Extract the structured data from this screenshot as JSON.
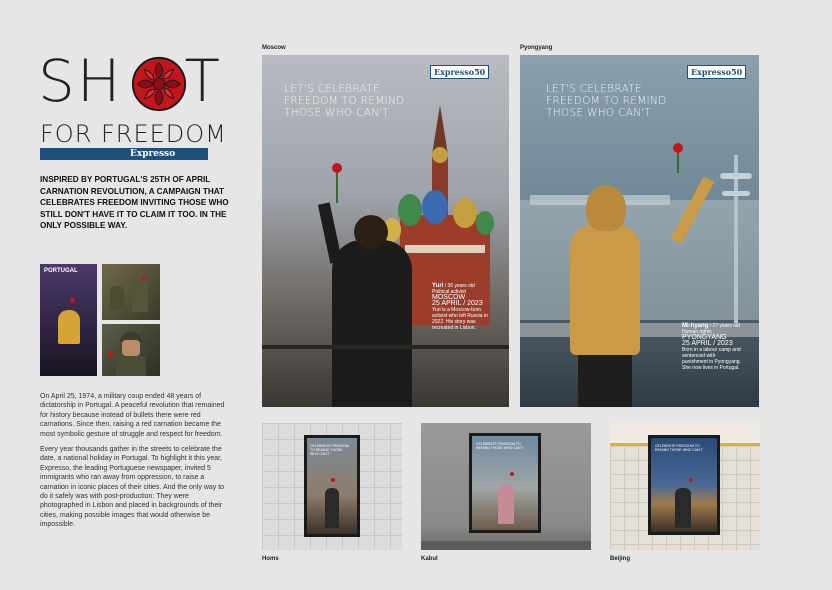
{
  "title": {
    "shot_left": "SH",
    "shot_right": "T",
    "subtitle": "FOR FREEDOM",
    "brand": "Expresso"
  },
  "headline": "INSPIRED BY PORTUGAL'S 25TH OF APRIL CARNATION REVOLUTION, A CAMPAIGN THAT CELEBRATES FREEDOM INVITING THOSE WHO STILL DON'T HAVE IT TO CLAIM IT TOO. IN THE ONLY POSSIBLE WAY.",
  "thumb_poster_text": "PORTUGAL",
  "body": {
    "p1": "On April 25, 1974, a military coup ended 48 years of dictatorship in Portugal. A peaceful revolution that remained for history because instead of bullets there were red carnations. Since then, raising a red carnation became the most symbolic gesture of struggle and respect for freedom.",
    "p2": "Every year thousands gather in the streets to celebrate the date, a national holiday in Portugal. To highlight it this year, Expresso, the leading Portuguese newspaper, invited 5 immigrants who ran away from oppression, to raise a carnation in iconic places of their cities. And the only way to do it safely was with post-production: They were photographed in Lisbon and placed in backgrounds of their cities, making possible images that would otherwise be impossible."
  },
  "posters": [
    {
      "caption": "Moscow",
      "headline": "LET'S CELEBRATE FREEDOM TO REMIND THOSE WHO CAN'T",
      "logo": "Expresso50",
      "name": "Yuri",
      "age": "/ 36 years old",
      "note": "Political activist",
      "city": "MOSCOW",
      "date": "25 APRIL / 2023",
      "small": "Yuri is a Moscow-born activist who left Russia in 2022. His story was recreated in Lisbon."
    },
    {
      "caption": "Pyongyang",
      "headline": "LET'S CELEBRATE FREEDOM TO REMIND THOSE WHO CAN'T",
      "logo": "Expresso50",
      "name": "Mi-hyang",
      "age": "/ 27 years old",
      "note": "Human rights",
      "city": "PYONGYANG",
      "date": "25 APRIL / 2023",
      "small": "Born in a labour camp and sentenced with punishment in Pyongyang. She now lives in Portugal."
    }
  ],
  "mockups": [
    {
      "caption": "Homs",
      "headline": "CELEBRATE FREEDOM TO REMIND THOSE WHO CAN'T"
    },
    {
      "caption": "Kabul",
      "headline": "CELEBRATE FREEDOM TO REMIND THOSE WHO CAN'T"
    },
    {
      "caption": "Beijing",
      "headline": "CELEBRATE FREEDOM TO REMIND THOSE WHO CAN'T"
    }
  ],
  "colors": {
    "background": "#e6e6e6",
    "brand_blue": "#1f4f7a",
    "carnation_red": "#c4151c"
  }
}
